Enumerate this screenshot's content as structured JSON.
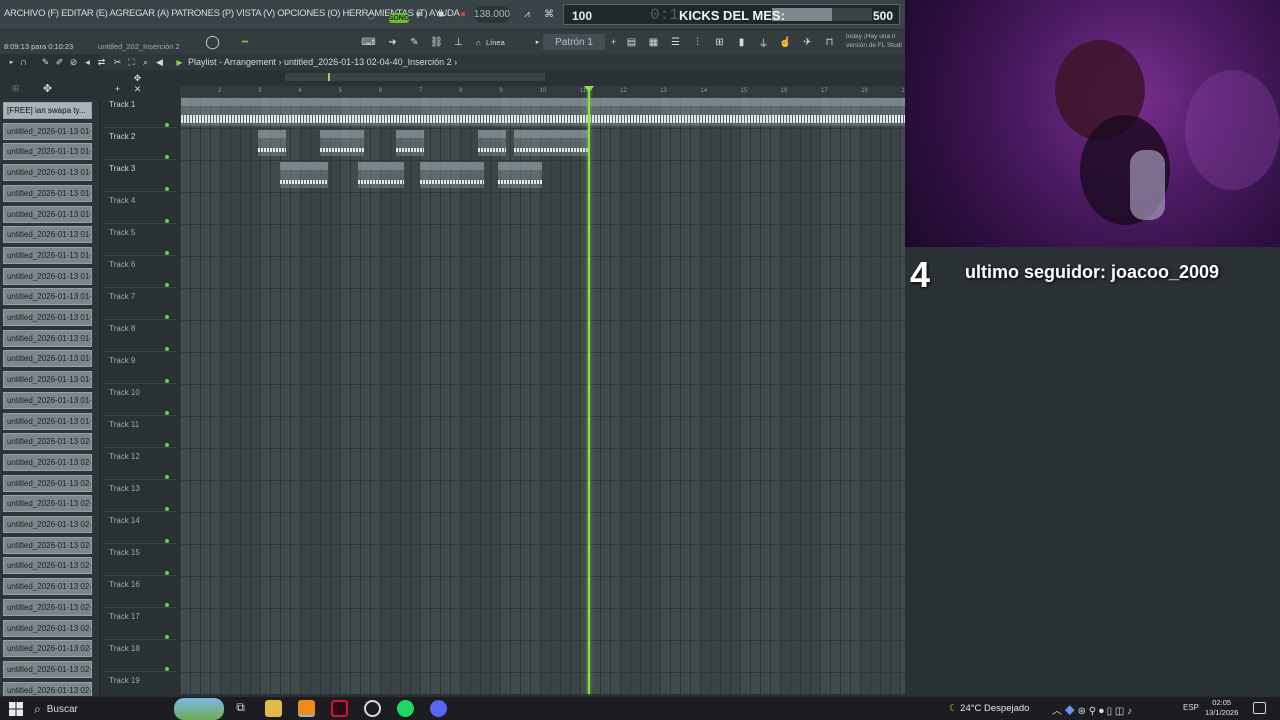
{
  "menu": {
    "items_text": "ARCHIVO (F) EDITAR (E) AGREGAR (A) PATRONES (P) VISTA (V) OPCIONES (O) HERRAMIENTAS (T) AYUDA"
  },
  "transport": {
    "mode_badge": "SONG",
    "tempo": "138.000"
  },
  "hint_panel": {
    "zoom": "100",
    "time": "0:1",
    "goal_title": "KICKS DEL MES:",
    "goal_value": "500",
    "goal_progress": 0.6
  },
  "toolbar2": {
    "cpu_text": "8:09:13 para 0:10:23",
    "project_short": "untitled_202_Inserción 2",
    "snap_label": "Línea",
    "pattern": "Patrón 1",
    "news_line1": "today  ¡Hay una n",
    "news_line2": "versión de FL Studi"
  },
  "playlist": {
    "title": "Playlist - Arrangement",
    "file": "untitled_2026-01-13 02-04-40_Inserción 2",
    "ruler_numbers": [
      "2",
      "3",
      "4",
      "5",
      "6",
      "7",
      "8",
      "9",
      "10",
      "11",
      "12",
      "13",
      "14",
      "15",
      "16",
      "17",
      "18",
      "19"
    ],
    "tracks": [
      {
        "name": "Track 1",
        "active": true
      },
      {
        "name": "Track 2",
        "active": true
      },
      {
        "name": "Track 3",
        "active": true
      },
      {
        "name": "Track 4",
        "active": false
      },
      {
        "name": "Track 5",
        "active": false
      },
      {
        "name": "Track 6",
        "active": false
      },
      {
        "name": "Track 7",
        "active": false
      },
      {
        "name": "Track 8",
        "active": false
      },
      {
        "name": "Track 9",
        "active": false
      },
      {
        "name": "Track 10",
        "active": false
      },
      {
        "name": "Track 11",
        "active": false
      },
      {
        "name": "Track 12",
        "active": false
      },
      {
        "name": "Track 13",
        "active": false
      },
      {
        "name": "Track 14",
        "active": false
      },
      {
        "name": "Track 15",
        "active": false
      },
      {
        "name": "Track 16",
        "active": false
      },
      {
        "name": "Track 17",
        "active": false
      },
      {
        "name": "Track 18",
        "active": false
      },
      {
        "name": "Track 19",
        "active": false
      }
    ],
    "clips": [
      {
        "label": "[FREE] ian  swapa type beat - heat",
        "track": 1
      },
      {
        "label": "un..",
        "track": 2
      },
      {
        "label": "untit..ión 2",
        "track": 2
      },
      {
        "label": "un..2",
        "track": 2
      },
      {
        "label": "un..2",
        "track": 2
      },
      {
        "label": "untitled_2...erción 2",
        "track": 2
      },
      {
        "label": "untitl..ión 2",
        "track": 3
      },
      {
        "label": "untitl..ión 2",
        "track": 3
      },
      {
        "label": "untitled..erción 2",
        "track": 3
      },
      {
        "label": "untit..ión 2",
        "track": 3
      }
    ]
  },
  "browser": {
    "items": [
      "[FREE] ian  swapa ty...",
      "untitled_2026-01-13 01-...",
      "untitled_2026-01-13 01-...",
      "untitled_2026-01-13 01-...",
      "untitled_2026-01-13 01-...",
      "untitled_2026-01-13 01-...",
      "untitled_2026-01-13 01-...",
      "untitled_2026-01-13 01-...",
      "untitled_2026-01-13 01-...",
      "untitled_2026-01-13 01-...",
      "untitled_2026-01-13 01-...",
      "untitled_2026-01-13 01-...",
      "untitled_2026-01-13 01-...",
      "untitled_2026-01-13 01-...",
      "untitled_2026-01-13 01-...",
      "untitled_2026-01-13 01-...",
      "untitled_2026-01-13 02-...",
      "untitled_2026-01-13 02-...",
      "untitled_2026-01-13 02-...",
      "untitled_2026-01-13 02-...",
      "untitled_2026-01-13 02-...",
      "untitled_2026-01-13 02-...",
      "untitled_2026-01-13 02-...",
      "untitled_2026-01-13 02-...",
      "untitled_2026-01-13 02-...",
      "untitled_2026-01-13 02-...",
      "untitled_2026-01-13 02-...",
      "untitled_2026-01-13 02-...",
      "untitled_2026-01-13 02-...",
      "untitled_2026-01-13 02-..."
    ]
  },
  "overlay": {
    "follower_count": "4",
    "follower_text": "ultimo seguidor: joacoo_2009"
  },
  "taskbar": {
    "search": "Buscar",
    "weather": "24°C  Despejado",
    "lang": "ESP",
    "time": "02:05",
    "date": "13/1/2026"
  },
  "colors": {
    "playhead": "#8fde4a",
    "song_badge": "#6fb63c",
    "led": "#6cd23e"
  }
}
